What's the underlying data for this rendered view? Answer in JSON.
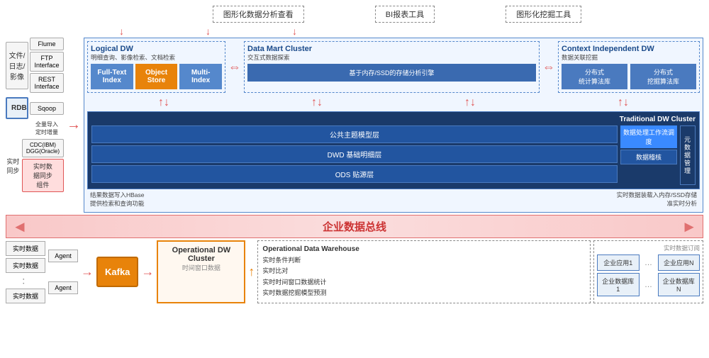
{
  "top_labels": {
    "label1": "图形化数据分析查看",
    "label2": "BI报表工具",
    "label3": "图形化挖掘工具"
  },
  "logical_dw": {
    "title": "Logical DW",
    "subtitle": "明细查询、影像检索、文档检索",
    "boxes": [
      {
        "label": "Full-Text\nIndex",
        "color": "blue"
      },
      {
        "label": "Object\nStore",
        "color": "orange"
      },
      {
        "label": "Multi-\nIndex",
        "color": "blue"
      }
    ]
  },
  "data_mart": {
    "title": "Data Mart Cluster",
    "subtitle": "交互式数据探索",
    "inner": "基于内存/SSD的存储分析引擎"
  },
  "context_dw": {
    "title": "Context Independent DW",
    "subtitle": "数据关联挖掘",
    "boxes": [
      "分布式\n统计算法库",
      "分布式\n挖掘算法库"
    ]
  },
  "traditional_dw": {
    "title": "Traditional DW Cluster",
    "layer1": "公共主题模型层",
    "layer2": "DWD 基础明细层",
    "layer3": "ODS 贴源层",
    "schedule": "数据处理工作流调度",
    "audit": "数据稽核",
    "meta": "元\n数\n据\n管\n理"
  },
  "annotations": {
    "left": "结果数据写入HBase\n提供检索和查询功能",
    "right": "实时数据装载入内存/SSD存储\n准实时分析"
  },
  "data_bus": {
    "label": "企业数据总线"
  },
  "left_sources": {
    "file_label": "文件/\n日志/\n影像",
    "flume": "Flume",
    "ftp": "FTP\nInterface",
    "rest": "REST\nInterface",
    "rdb": "RDB",
    "sqoop": "Sqoop",
    "cdc": "CDC(IBM)\nDGG(Oracle)",
    "import_label": "全量导入\n定时增量",
    "realtime_label": "实时同步",
    "realtime_comp": "实时数\n据同步\n组件"
  },
  "bottom": {
    "rt1": "实时数据",
    "rt2": "实时数据",
    "rt3": "：",
    "rt4": "实时数据",
    "agent1": "Agent",
    "agent2": "Agent",
    "kafka": "Kafka",
    "op_cluster_title": "Operational DW\nCluster",
    "op_cluster_sub": "时间窗口数据",
    "odw_title": "Operational Data Warehouse",
    "odw_items": [
      "实时条件判断",
      "实时比对",
      "实时时间窗口数据统计",
      "实时数据挖掘模型预测"
    ],
    "rt_subscribe": "实时数据订阅",
    "apps": [
      {
        "label": "企业应用1"
      },
      {
        "ellipsis": "..."
      },
      {
        "label": "企业应用N"
      },
      {
        "label": "企业数据库1"
      },
      {
        "ellipsis": "..."
      },
      {
        "label": "企业数据库N"
      }
    ]
  }
}
